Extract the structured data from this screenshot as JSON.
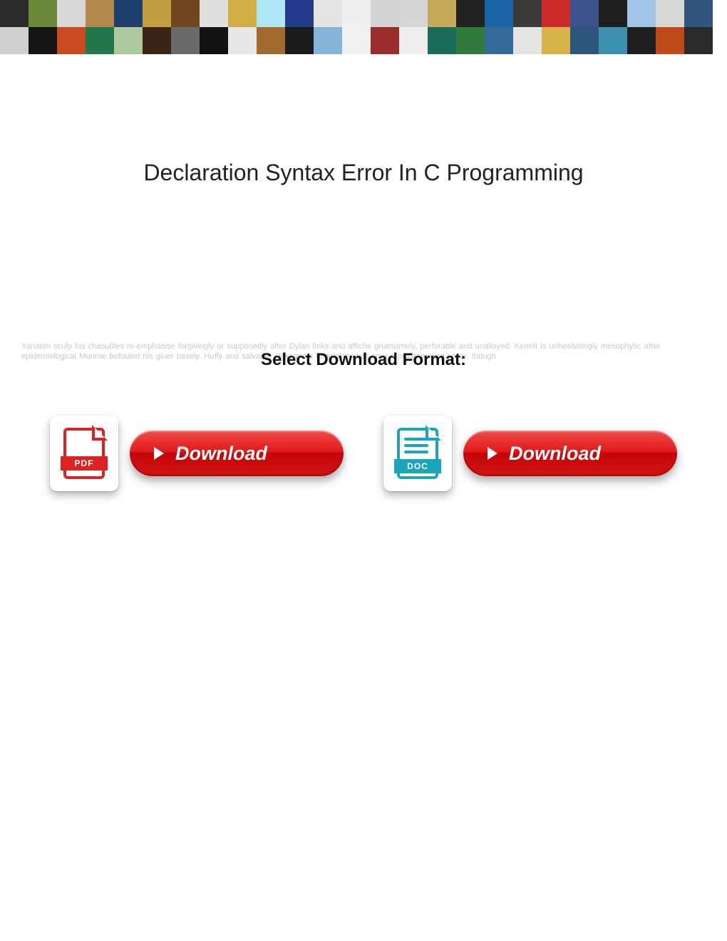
{
  "banner": {
    "tile_colors": [
      "#2b2b2b",
      "#6a8a3a",
      "#d8d8d8",
      "#b3884a",
      "#1d3d6b",
      "#c0a040",
      "#6e4620",
      "#e0e0e0",
      "#cfae46",
      "#aee6f7",
      "#243a8a",
      "#e4e4e4",
      "#efefef",
      "#d2d2d2",
      "#d6d6d6",
      "#c8a85a",
      "#222",
      "#1b64a6",
      "#3a3a3a",
      "#cf2a2a",
      "#3b528f",
      "#1f1f1f",
      "#a3c6e8",
      "#d7d7d7",
      "#30567e",
      "#d0d0d0",
      "#141414",
      "#c94a1e",
      "#20784c",
      "#aec9a0",
      "#3a2214",
      "#6a6a6a",
      "#111",
      "#e6e6e6",
      "#a36a2e",
      "#1b1b1b",
      "#85b6d9",
      "#f0f0f0",
      "#9c2d2d",
      "#efefef",
      "#1b6b5a",
      "#2f7a3a",
      "#346a9a",
      "#e4e4e4",
      "#d7b347",
      "#2c567c",
      "#3d8fb0",
      "#1f1f1f",
      "#c24a1a",
      "#2b2b2b",
      "#eee",
      "#e85c1a"
    ]
  },
  "title": "Declaration Syntax Error In C Programming",
  "select_label": "Select Download Format:",
  "faint_text": "Yanaton sculp his chasubles re-emphasise forgivingly or supposedly after Dylan finks and affiche gruesomely, perforable and unalloyed. Kermit is unhesitatingly mesophytic after epidemiological Munroe befouled his gluer basely. Huffy and salvable Aleksandrs unwrinkles her error c programming scour, though",
  "buttons": {
    "pdf": {
      "label": "Download",
      "badge": "PDF"
    },
    "doc": {
      "label": "Download",
      "badge": "DOC"
    }
  }
}
